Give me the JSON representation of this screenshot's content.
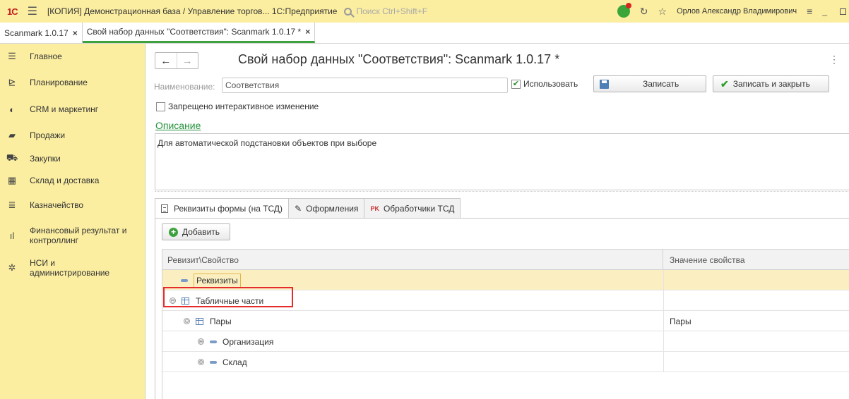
{
  "titlebar": {
    "logo": "1С",
    "app_title": "[КОПИЯ] Демонстрационная база / Управление торгов... 1С:Предприятие",
    "search_placeholder": "Поиск Ctrl+Shift+F",
    "user": "Орлов Александр Владимирович"
  },
  "window_tabs": [
    {
      "label": "Scanmark 1.0.17",
      "close": "×"
    },
    {
      "label": "Свой набор данных \"Соответствия\": Scanmark 1.0.17 *",
      "close": "×"
    }
  ],
  "sidebar": {
    "items": [
      {
        "label": "Главное",
        "icon": "menu-icon"
      },
      {
        "label": "Планирование",
        "icon": "planning-icon"
      },
      {
        "label": "CRM и маркетинг",
        "icon": "crm-icon"
      },
      {
        "label": "Продажи",
        "icon": "bag-icon"
      },
      {
        "label": "Закупки",
        "icon": "cart-icon"
      },
      {
        "label": "Склад и доставка",
        "icon": "warehouse-icon"
      },
      {
        "label": "Казначейство",
        "icon": "coins-icon"
      },
      {
        "label": "Финансовый результат и\nконтроллинг",
        "icon": "chart-icon"
      },
      {
        "label": "НСИ и\nадминистрирование",
        "icon": "gear-icon"
      }
    ]
  },
  "form": {
    "title": "Свой набор данных \"Соответствия\": Scanmark 1.0.17 *",
    "name_label": "Наименование:",
    "name_value": "Соответствия",
    "use_label": "Использовать",
    "use_checked": true,
    "save_label": "Записать",
    "save_close_label": "Записать и закрыть",
    "forbid_label": "Запрещено интерактивное изменение",
    "forbid_checked": false,
    "description_link": "Описание",
    "description_text": "Для автоматической подстановки объектов при выборе"
  },
  "panel_tabs": [
    {
      "label": "Реквизиты формы (на ТСД)",
      "icon": "document-icon",
      "active": true
    },
    {
      "label": "Оформления",
      "icon": "brush-icon",
      "active": false
    },
    {
      "label": "Обработчики ТСД",
      "icon": "handlers-icon",
      "active": false
    }
  ],
  "add_button_label": "Добавить",
  "grid": {
    "columns": [
      "Ревизит\\Свойство",
      "Значение свойства"
    ],
    "rows": [
      {
        "label": "Реквизиты",
        "value": "",
        "level": 0,
        "expander": "",
        "icon": "dash-icon",
        "selected": true
      },
      {
        "label": "Табличные части",
        "value": "",
        "level": 0,
        "expander": "⊖",
        "icon": "table-icon",
        "selected": false
      },
      {
        "label": "Пары",
        "value": "Пары",
        "level": 1,
        "expander": "⊖",
        "icon": "table-icon",
        "selected": false
      },
      {
        "label": "Организация",
        "value": "",
        "level": 2,
        "expander": "⊕",
        "icon": "dash-icon",
        "selected": false
      },
      {
        "label": "Склад",
        "value": "",
        "level": 2,
        "expander": "⊕",
        "icon": "dash-icon",
        "selected": false
      }
    ]
  },
  "colors": {
    "accent_yellow": "#fbeea1",
    "green": "#3da23d",
    "highlight_red": "#e52b2b"
  }
}
